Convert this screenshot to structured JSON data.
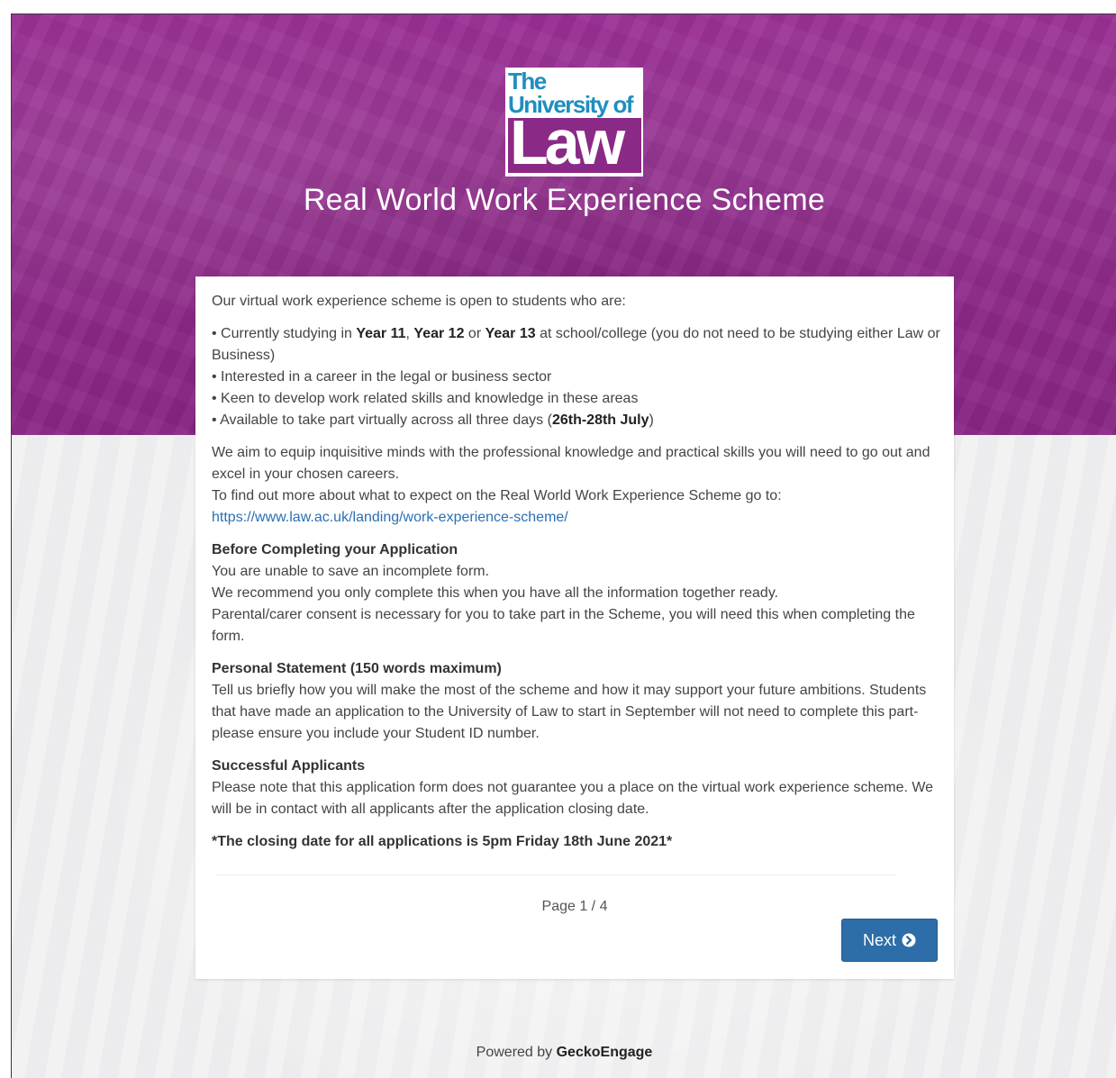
{
  "header": {
    "logo_line1": "The",
    "logo_line2": "University of",
    "logo_line3": "Law",
    "title": "Real World Work Experience Scheme"
  },
  "intro": {
    "lead": "Our virtual work experience scheme is open to students who are:",
    "bullet1_prefix": "• Currently studying in ",
    "bullet1_year11": "Year 11",
    "bullet1_sep1": ", ",
    "bullet1_year12": "Year 12",
    "bullet1_sep2": " or ",
    "bullet1_year13": "Year 13",
    "bullet1_suffix": " at school/college (you do not need to be studying either Law or Business)",
    "bullet2": "• Interested in a career in the legal or business sector",
    "bullet3": "• Keen to develop work related skills and knowledge in these areas",
    "bullet4_prefix": "• Available to take part virtually across all three days (",
    "bullet4_dates": "26th-28th July",
    "bullet4_suffix": ")"
  },
  "aim": {
    "text1": "We aim to equip inquisitive minds with the professional knowledge and practical skills you will need to go out and excel in your chosen careers.",
    "text2": "To find out more about what to expect on the Real World Work Experience Scheme go to:",
    "link": "https://www.law.ac.uk/landing/work-experience-scheme/"
  },
  "before": {
    "heading": "Before Completing your Application",
    "line1": "You are unable to save an incomplete form.",
    "line2": "We recommend you only complete this when you have all the information together ready.",
    "line3": "Parental/carer consent is necessary for you to take part in the Scheme, you will need this when completing the form."
  },
  "statement": {
    "heading": "Personal Statement (150 words maximum)",
    "text": "Tell us briefly how you will make the most of the scheme and how it may support your future ambitions. Students that have made an application to the University of Law to start in September will not need to complete this part- please ensure you include your Student ID number."
  },
  "successful": {
    "heading": "Successful Applicants",
    "text": "Please note that this application form does not guarantee you a place on the virtual work experience scheme. We will be in contact with all applicants after the application closing date."
  },
  "closing": "*The closing date for all applications is 5pm Friday 18th June 2021*",
  "pagination": {
    "indicator": "Page 1 / 4",
    "next_label": "Next",
    "next_icon": "chevron-circle-right-icon"
  },
  "footer": {
    "prefix": "Powered by ",
    "brand": "GeckoEngage"
  },
  "colors": {
    "hero_purple": "#8f2a8a",
    "logo_blue": "#1f8ec0",
    "button_blue": "#2d6ea8",
    "link_blue": "#2a6fb4"
  }
}
